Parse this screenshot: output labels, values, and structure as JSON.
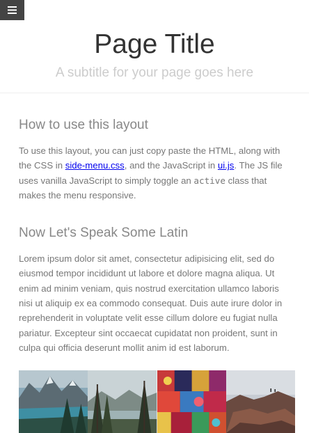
{
  "menu": {
    "icon": "hamburger-icon"
  },
  "header": {
    "title": "Page Title",
    "subtitle": "A subtitle for your page goes here"
  },
  "section1": {
    "heading": "How to use this layout",
    "text_before_link1": "To use this layout, you can just copy paste the HTML, along with the CSS in ",
    "link1": "side-menu.css",
    "text_between_links": ", and the JavaScript in ",
    "link2": "ui.js",
    "text_before_code": ". The JS file uses vanilla JavaScript to simply toggle an ",
    "code": "active",
    "text_after_code": " class that makes the menu responsive."
  },
  "section2": {
    "heading": "Now Let's Speak Some Latin",
    "paragraph": "Lorem ipsum dolor sit amet, consectetur adipisicing elit, sed do eiusmod tempor incididunt ut labore et dolore magna aliqua. Ut enim ad minim veniam, quis nostrud exercitation ullamco laboris nisi ut aliquip ex ea commodo consequat. Duis aute irure dolor in reprehenderit in voluptate velit esse cillum dolore eu fugiat nulla pariatur. Excepteur sint occaecat cupidatat non proident, sunt in culpa qui officia deserunt mollit anim id est laborum."
  },
  "photos": [
    {
      "name": "mountain-lake-photo"
    },
    {
      "name": "forest-lake-photo"
    },
    {
      "name": "market-stall-photo"
    },
    {
      "name": "rock-arch-photo"
    }
  ]
}
